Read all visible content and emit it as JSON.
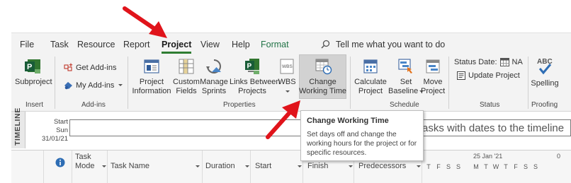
{
  "ribbon": {
    "tabs": [
      {
        "label": "File"
      },
      {
        "label": "Task"
      },
      {
        "label": "Resource"
      },
      {
        "label": "Report"
      },
      {
        "label": "Project",
        "active": true
      },
      {
        "label": "View"
      },
      {
        "label": "Help"
      },
      {
        "label": "Format"
      }
    ],
    "tell_me": "Tell me what you want to do",
    "groups": {
      "insert": {
        "label": "Insert",
        "subproject": "Subproject"
      },
      "addins": {
        "label": "Add-ins",
        "get": "Get Add-ins",
        "my": "My Add-ins"
      },
      "properties": {
        "label": "Properties",
        "project_information": [
          "Project",
          "Information"
        ],
        "custom_fields": [
          "Custom",
          "Fields"
        ],
        "manage_sprints": [
          "Manage",
          "Sprints"
        ],
        "links_between": [
          "Links Between",
          "Projects"
        ],
        "wbs": "WBS",
        "change_working_time": [
          "Change",
          "Working Time"
        ]
      },
      "schedule": {
        "label": "Schedule",
        "calculate_project": [
          "Calculate",
          "Project"
        ],
        "set_baseline": [
          "Set",
          "Baseline"
        ],
        "move_project": [
          "Move",
          "Project"
        ]
      },
      "status": {
        "label": "Status",
        "status_date_label": "Status Date:",
        "status_date_value": "NA",
        "update_project": "Update Project"
      },
      "proofing": {
        "label": "Proofing",
        "spelling": "Spelling",
        "abc": "ABC"
      }
    }
  },
  "tooltip": {
    "title": "Change Working Time",
    "body": [
      "Set days off and change the",
      "working hours for the project or for",
      "specific resources."
    ]
  },
  "timeline": {
    "label": "TIMELINE",
    "start_label": "Start",
    "start_date": "Sun 31/01/21",
    "placeholder_text": "asks with dates to the timeline"
  },
  "grid": {
    "columns": {
      "task_mode": [
        "Task",
        "Mode"
      ],
      "task_name": "Task Name",
      "duration": "Duration",
      "start": "Start",
      "finish": "Finish",
      "predecessors": "Predecessors"
    },
    "gantt": {
      "week1_days": [
        "T",
        "F",
        "S",
        "S"
      ],
      "week2_label": "25 Jan '21",
      "week2_days": [
        "M",
        "T",
        "W",
        "T",
        "F",
        "S",
        "S"
      ],
      "week3_label": "0"
    }
  },
  "colors": {
    "accent_green": "#2f7d32",
    "arrow_red": "#e0141b",
    "ribbon_bg": "#f3f3f3"
  }
}
